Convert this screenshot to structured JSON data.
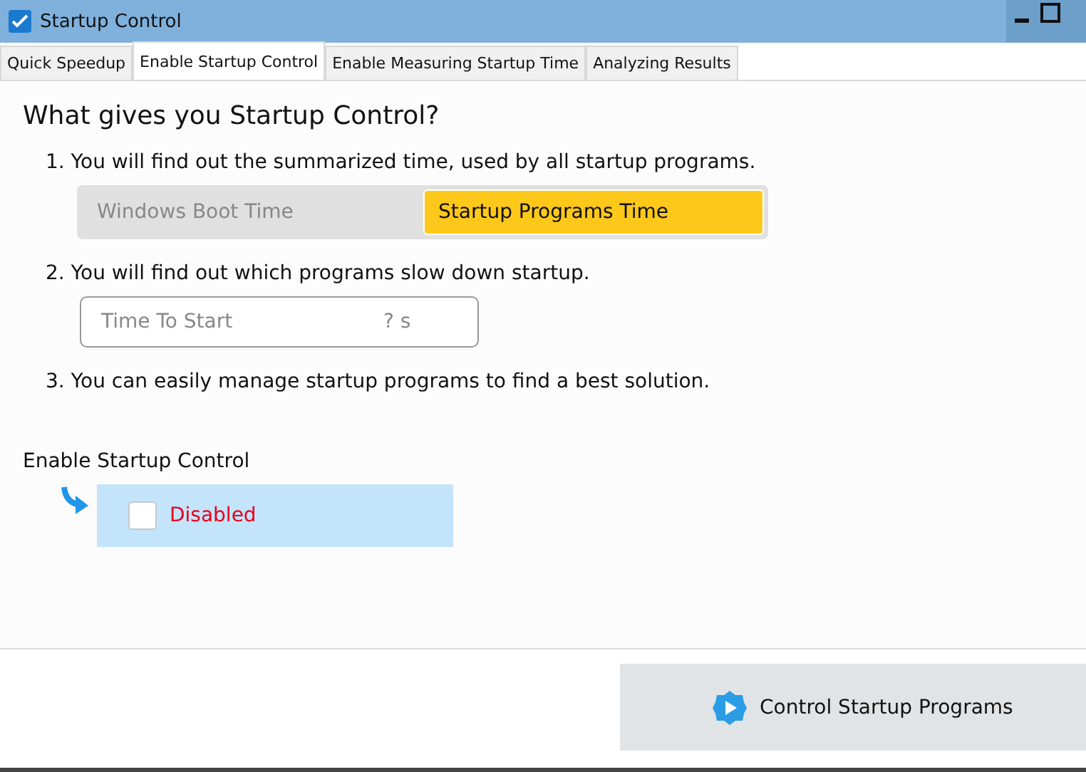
{
  "window": {
    "title": "Startup Control"
  },
  "tabs": [
    {
      "label": "Quick Speedup",
      "selected": false
    },
    {
      "label": "Enable Startup Control",
      "selected": true
    },
    {
      "label": "Enable Measuring Startup Time",
      "selected": false
    },
    {
      "label": "Analyzing Results",
      "selected": false
    }
  ],
  "heading": "What gives you Startup Control?",
  "steps": [
    {
      "text": "1. You will find out the summarized time, used by all startup programs.",
      "kind": "segments",
      "segments": [
        {
          "label": "Windows Boot Time",
          "selected": false
        },
        {
          "label": "Startup Programs Time",
          "selected": true
        }
      ]
    },
    {
      "text": "2. You will find out which programs slow down startup.",
      "kind": "field",
      "field": {
        "label": "Time To Start",
        "value": "? s"
      }
    },
    {
      "text": "3. You can easily manage startup programs to find a best solution.",
      "kind": "plain"
    }
  ],
  "enable": {
    "label": "Enable Startup Control",
    "checkbox": {
      "label": "Disabled",
      "checked": false
    }
  },
  "action_button": "Control Startup Programs"
}
